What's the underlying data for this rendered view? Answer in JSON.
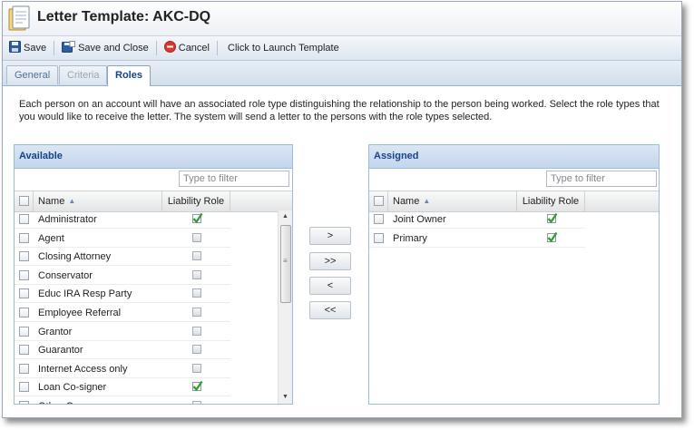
{
  "window": {
    "title": "Letter Template: AKC-DQ"
  },
  "toolbar": {
    "save_label": "Save",
    "save_close_label": "Save and Close",
    "cancel_label": "Cancel",
    "launch_label": "Click to Launch Template"
  },
  "tabs": [
    {
      "label": "General",
      "state": "normal"
    },
    {
      "label": "Criteria",
      "state": "disabled"
    },
    {
      "label": "Roles",
      "state": "active"
    }
  ],
  "description": "Each person on an account will have an associated role type distinguishing the relationship to the person being worked. Select the role types that you would like to receive the letter. The system will send a letter to the persons with the role types selected.",
  "available": {
    "title": "Available",
    "filter_placeholder": "Type to filter",
    "columns": {
      "name": "Name",
      "liability": "Liability Role"
    },
    "rows": [
      {
        "name": "Administrator",
        "liability": true
      },
      {
        "name": "Agent",
        "liability": false
      },
      {
        "name": "Closing Attorney",
        "liability": false
      },
      {
        "name": "Conservator",
        "liability": false
      },
      {
        "name": "Educ IRA Resp Party",
        "liability": false
      },
      {
        "name": "Employee Referral",
        "liability": false
      },
      {
        "name": "Grantor",
        "liability": false
      },
      {
        "name": "Guarantor",
        "liability": false
      },
      {
        "name": "Internet Access only",
        "liability": false
      },
      {
        "name": "Loan Co-signer",
        "liability": true
      },
      {
        "name": "Other Owner",
        "liability": false
      }
    ]
  },
  "move_buttons": {
    "add_selected": ">",
    "add_all": ">>",
    "remove_selected": "<",
    "remove_all": "<<"
  },
  "assigned": {
    "title": "Assigned",
    "filter_placeholder": "Type to filter",
    "columns": {
      "name": "Name",
      "liability": "Liability Role"
    },
    "rows": [
      {
        "name": "Joint Owner",
        "liability": true
      },
      {
        "name": "Primary",
        "liability": true
      }
    ]
  },
  "colors": {
    "panel_header_text": "#15428b",
    "panel_border": "#99bbe8",
    "check_green": "#2e9e2e",
    "cancel_red": "#d9392c"
  },
  "icons": [
    "document-icon",
    "save-icon",
    "save-close-icon",
    "cancel-icon",
    "sort-ascending-icon",
    "checkmark-icon"
  ]
}
